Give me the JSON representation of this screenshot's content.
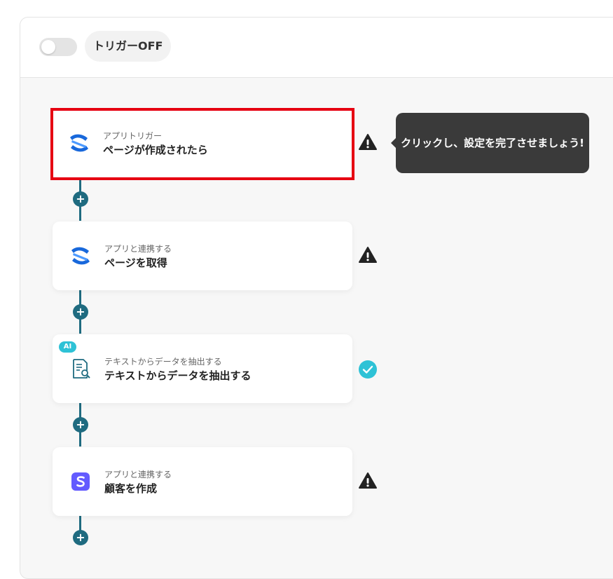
{
  "header": {
    "trigger_label": "トリガーOFF",
    "trigger_enabled": false
  },
  "tooltip": {
    "text": "クリックし、設定を完了させましょう!"
  },
  "steps": [
    {
      "sub": "アプリトリガー",
      "title": "ページが作成されたら",
      "icon": "confluence-icon",
      "status": "warning"
    },
    {
      "sub": "アプリと連携する",
      "title": "ページを取得",
      "icon": "confluence-icon",
      "status": "warning"
    },
    {
      "sub": "テキストからデータを抽出する",
      "title": "テキストからデータを抽出する",
      "icon": "document-search-icon",
      "status": "complete",
      "badge": "AI"
    },
    {
      "sub": "アプリと連携する",
      "title": "顧客を作成",
      "icon": "stripe-icon",
      "status": "warning"
    }
  ],
  "colors": {
    "connector": "#1f6b80",
    "highlight": "#e60012",
    "warning": "#222222",
    "complete": "#2ec2d6",
    "confluence": "#1868db",
    "stripe": "#635bff"
  },
  "plus_glyph": "+"
}
